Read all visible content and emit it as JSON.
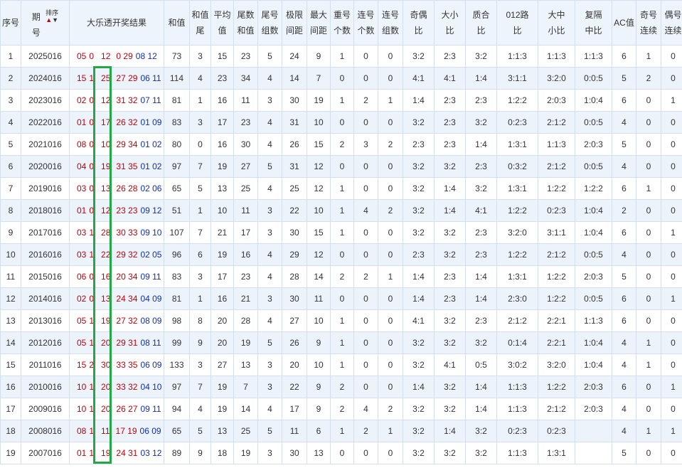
{
  "headers": {
    "seq": "序号",
    "period_l1": "期",
    "period_l2": "号",
    "sort_label": "排序",
    "sort_up": "▲",
    "sort_down": "▼",
    "draw": "大乐透开奖结果",
    "sum": "和值",
    "sum_tail_1": "和值",
    "sum_tail_2": "尾",
    "avg_1": "平均",
    "avg_2": "值",
    "tail_sum_1": "尾数",
    "tail_sum_2": "和值",
    "tail_groups_1": "尾号",
    "tail_groups_2": "组数",
    "span_1": "极限",
    "span_2": "间距",
    "max_gap_1": "最大",
    "max_gap_2": "间距",
    "repeat_1": "重号",
    "repeat_2": "个数",
    "consec_1": "连号",
    "consec_2": "个数",
    "consec_groups_1": "连号",
    "consec_groups_2": "组数",
    "odd_even_1": "奇偶",
    "odd_even_2": "比",
    "big_small_1": "大小",
    "big_small_2": "比",
    "prime_1": "质合",
    "prime_2": "比",
    "road_1": "012路",
    "road_2": "比",
    "bms_1": "大中",
    "bms_2": "小比",
    "rep_1": "复隔",
    "rep_2": "中比",
    "ac": "AC值",
    "odd_run_1": "奇号",
    "odd_run_2": "连续",
    "even_run_1": "偶号",
    "even_run_2": "连续"
  },
  "rows": [
    {
      "seq": "1",
      "period": "2025016",
      "r1": "05",
      "r2": "0",
      "r3": "12",
      "r4": "0 29",
      "b": "08 12",
      "sum": "73",
      "st": "3",
      "avg": "15",
      "ts": "23",
      "tg": "5",
      "sp": "24",
      "mg": "9",
      "rp": "1",
      "cn": "0",
      "cg": "0",
      "oe": "3:2",
      "bs": "2:3",
      "pc": "3:2",
      "rd": "1:1:3",
      "bms": "1:1:3",
      "rep": "1:1:3",
      "ac": "6",
      "or": "1",
      "er": "0"
    },
    {
      "seq": "2",
      "period": "2024016",
      "r1": "15",
      "r2": "1",
      "r3": "25",
      "r4": "27 29",
      "b": "06 11",
      "sum": "114",
      "st": "4",
      "avg": "23",
      "ts": "34",
      "tg": "4",
      "sp": "14",
      "mg": "7",
      "rp": "0",
      "cn": "0",
      "cg": "0",
      "oe": "4:1",
      "bs": "4:1",
      "pc": "1:4",
      "rd": "3:1:1",
      "bms": "3:2:0",
      "rep": "0:0:5",
      "ac": "5",
      "or": "2",
      "er": "0"
    },
    {
      "seq": "3",
      "period": "2023016",
      "r1": "02",
      "r2": "0",
      "r3": "12",
      "r4": "31 32",
      "b": "07 11",
      "sum": "81",
      "st": "1",
      "avg": "16",
      "ts": "11",
      "tg": "3",
      "sp": "30",
      "mg": "19",
      "rp": "1",
      "cn": "2",
      "cg": "1",
      "oe": "1:4",
      "bs": "2:3",
      "pc": "2:3",
      "rd": "1:2:2",
      "bms": "2:0:3",
      "rep": "1:0:4",
      "ac": "6",
      "or": "0",
      "er": "1"
    },
    {
      "seq": "4",
      "period": "2022016",
      "r1": "01",
      "r2": "0",
      "r3": "17",
      "r4": "26 32",
      "b": "01 09",
      "sum": "83",
      "st": "3",
      "avg": "17",
      "ts": "23",
      "tg": "4",
      "sp": "31",
      "mg": "10",
      "rp": "0",
      "cn": "0",
      "cg": "0",
      "oe": "3:2",
      "bs": "2:3",
      "pc": "3:2",
      "rd": "0:2:3",
      "bms": "2:1:2",
      "rep": "0:0:5",
      "ac": "4",
      "or": "0",
      "er": "0"
    },
    {
      "seq": "5",
      "period": "2021016",
      "r1": "08",
      "r2": "0",
      "r3": "10",
      "r4": "29 34",
      "b": "01 02",
      "sum": "80",
      "st": "0",
      "avg": "16",
      "ts": "30",
      "tg": "4",
      "sp": "26",
      "mg": "15",
      "rp": "2",
      "cn": "3",
      "cg": "2",
      "oe": "2:3",
      "bs": "2:3",
      "pc": "1:4",
      "rd": "1:3:1",
      "bms": "1:1:3",
      "rep": "2:0:3",
      "ac": "5",
      "or": "0",
      "er": "0"
    },
    {
      "seq": "6",
      "period": "2020016",
      "r1": "04",
      "r2": "0",
      "r3": "19",
      "r4": "31 35",
      "b": "01 02",
      "sum": "97",
      "st": "7",
      "avg": "19",
      "ts": "27",
      "tg": "5",
      "sp": "31",
      "mg": "12",
      "rp": "0",
      "cn": "0",
      "cg": "0",
      "oe": "3:2",
      "bs": "3:2",
      "pc": "2:3",
      "rd": "0:3:2",
      "bms": "2:1:2",
      "rep": "0:0:5",
      "ac": "4",
      "or": "0",
      "er": "0"
    },
    {
      "seq": "7",
      "period": "2019016",
      "r1": "03",
      "r2": "0",
      "r3": "13",
      "r4": "26 28",
      "b": "02 06",
      "sum": "65",
      "st": "5",
      "avg": "13",
      "ts": "25",
      "tg": "4",
      "sp": "25",
      "mg": "12",
      "rp": "1",
      "cn": "0",
      "cg": "0",
      "oe": "3:2",
      "bs": "1:4",
      "pc": "3:2",
      "rd": "1:3:1",
      "bms": "1:2:2",
      "rep": "1:2:2",
      "ac": "6",
      "or": "1",
      "er": "0"
    },
    {
      "seq": "8",
      "period": "2018016",
      "r1": "01",
      "r2": "0",
      "r3": "12",
      "r4": "23 23",
      "b": "09 12",
      "sum": "51",
      "st": "1",
      "avg": "10",
      "ts": "11",
      "tg": "3",
      "sp": "22",
      "mg": "10",
      "rp": "1",
      "cn": "4",
      "cg": "2",
      "oe": "3:2",
      "bs": "1:4",
      "pc": "4:1",
      "rd": "1:2:2",
      "bms": "0:2:3",
      "rep": "1:0:4",
      "ac": "2",
      "or": "0",
      "er": "0"
    },
    {
      "seq": "9",
      "period": "2017016",
      "r1": "03",
      "r2": "1",
      "r3": "28",
      "r4": "30 33",
      "b": "09 10",
      "sum": "107",
      "st": "7",
      "avg": "21",
      "ts": "17",
      "tg": "3",
      "sp": "30",
      "mg": "15",
      "rp": "1",
      "cn": "0",
      "cg": "0",
      "oe": "3:2",
      "bs": "3:2",
      "pc": "2:3",
      "rd": "3:2:0",
      "bms": "3:1:1",
      "rep": "1:0:4",
      "ac": "6",
      "or": "0",
      "er": "1"
    },
    {
      "seq": "10",
      "period": "2016016",
      "r1": "03",
      "r2": "1",
      "r3": "22",
      "r4": "29 32",
      "b": "02 05",
      "sum": "96",
      "st": "6",
      "avg": "19",
      "ts": "16",
      "tg": "4",
      "sp": "29",
      "mg": "12",
      "rp": "0",
      "cn": "0",
      "cg": "0",
      "oe": "2:3",
      "bs": "3:2",
      "pc": "2:3",
      "rd": "1:2:2",
      "bms": "2:1:2",
      "rep": "0:0:5",
      "ac": "4",
      "or": "0",
      "er": "0"
    },
    {
      "seq": "11",
      "period": "2015016",
      "r1": "06",
      "r2": "0",
      "r3": "16",
      "r4": "20 34",
      "b": "09 11",
      "sum": "83",
      "st": "3",
      "avg": "17",
      "ts": "23",
      "tg": "4",
      "sp": "28",
      "mg": "14",
      "rp": "2",
      "cn": "2",
      "cg": "1",
      "oe": "1:4",
      "bs": "2:3",
      "pc": "1:4",
      "rd": "1:3:1",
      "bms": "1:2:2",
      "rep": "2:0:3",
      "ac": "5",
      "or": "0",
      "er": "0"
    },
    {
      "seq": "12",
      "period": "2014016",
      "r1": "02",
      "r2": "0",
      "r3": "13",
      "r4": "24 34",
      "b": "04 09",
      "sum": "81",
      "st": "1",
      "avg": "16",
      "ts": "21",
      "tg": "3",
      "sp": "30",
      "mg": "11",
      "rp": "0",
      "cn": "0",
      "cg": "0",
      "oe": "1:4",
      "bs": "2:3",
      "pc": "1:4",
      "rd": "2:3:0",
      "bms": "1:2:2",
      "rep": "0:0:5",
      "ac": "6",
      "or": "0",
      "er": "1"
    },
    {
      "seq": "13",
      "period": "2013016",
      "r1": "05",
      "r2": "1",
      "r3": "19",
      "r4": "27 32",
      "b": "08 09",
      "sum": "98",
      "st": "8",
      "avg": "20",
      "ts": "28",
      "tg": "4",
      "sp": "27",
      "mg": "10",
      "rp": "1",
      "cn": "0",
      "cg": "0",
      "oe": "4:1",
      "bs": "3:2",
      "pc": "2:3",
      "rd": "2:1:2",
      "bms": "2:2:1",
      "rep": "1:1:3",
      "ac": "6",
      "or": "0",
      "er": "0"
    },
    {
      "seq": "14",
      "period": "2012016",
      "r1": "05",
      "r2": "1",
      "r3": "20",
      "r4": "29 31",
      "b": "08 11",
      "sum": "99",
      "st": "9",
      "avg": "20",
      "ts": "19",
      "tg": "5",
      "sp": "26",
      "mg": "9",
      "rp": "1",
      "cn": "0",
      "cg": "0",
      "oe": "3:2",
      "bs": "3:2",
      "pc": "3:2",
      "rd": "0:1:4",
      "bms": "2:2:1",
      "rep": "1:0:4",
      "ac": "4",
      "or": "1",
      "er": "0"
    },
    {
      "seq": "15",
      "period": "2011016",
      "r1": "15",
      "r2": "2",
      "r3": "30",
      "r4": "33 35",
      "b": "06 09",
      "sum": "133",
      "st": "3",
      "avg": "27",
      "ts": "13",
      "tg": "3",
      "sp": "20",
      "mg": "10",
      "rp": "1",
      "cn": "0",
      "cg": "0",
      "oe": "3:2",
      "bs": "4:1",
      "pc": "0:5",
      "rd": "3:0:2",
      "bms": "3:2:0",
      "rep": "1:0:4",
      "ac": "4",
      "or": "1",
      "er": "0"
    },
    {
      "seq": "16",
      "period": "2010016",
      "r1": "10",
      "r2": "1",
      "r3": "20",
      "r4": "33 32",
      "b": "04 10",
      "sum": "97",
      "st": "7",
      "avg": "19",
      "ts": "7",
      "tg": "3",
      "sp": "22",
      "mg": "9",
      "rp": "2",
      "cn": "0",
      "cg": "0",
      "oe": "1:4",
      "bs": "3:2",
      "pc": "1:4",
      "rd": "1:1:3",
      "bms": "1:2:2",
      "rep": "2:0:3",
      "ac": "6",
      "or": "0",
      "er": "1"
    },
    {
      "seq": "17",
      "period": "2009016",
      "r1": "10",
      "r2": "1",
      "r3": "20",
      "r4": "26 27",
      "b": "09 11",
      "sum": "94",
      "st": "4",
      "avg": "19",
      "ts": "14",
      "tg": "4",
      "sp": "17",
      "mg": "9",
      "rp": "2",
      "cn": "4",
      "cg": "2",
      "oe": "3:2",
      "bs": "3:2",
      "pc": "1:4",
      "rd": "1:1:3",
      "bms": "2:1:2",
      "rep": "2:0:3",
      "ac": "4",
      "or": "0",
      "er": "0"
    },
    {
      "seq": "18",
      "period": "2008016",
      "r1": "08",
      "r2": "1",
      "r3": "11",
      "r4": "17 19",
      "b": "06 09",
      "sum": "65",
      "st": "5",
      "avg": "13",
      "ts": "25",
      "tg": "5",
      "sp": "11",
      "mg": "6",
      "rp": "1",
      "cn": "2",
      "cg": "1",
      "oe": "3:2",
      "bs": "1:4",
      "pc": "3:2",
      "rd": "0:2:3",
      "bms": "0:2:3",
      "rep": "",
      "ac": "4",
      "or": "1",
      "er": "1"
    },
    {
      "seq": "19",
      "period": "2007016",
      "r1": "01",
      "r2": "1",
      "r3": "19",
      "r4": "24 31",
      "b": "03 12",
      "sum": "89",
      "st": "9",
      "avg": "18",
      "ts": "19",
      "tg": "3",
      "sp": "30",
      "mg": "13",
      "rp": "0",
      "cn": "0",
      "cg": "0",
      "oe": "3:2",
      "bs": "3:2",
      "pc": "3:2",
      "rd": "1:1:3",
      "bms": "1:3:1",
      "rep": "",
      "ac": "5",
      "or": "0",
      "er": "0"
    }
  ],
  "colors": {
    "red": "#c0000c",
    "blue": "#1030b0",
    "highlight": "#22a844",
    "header_bg": "#eef4fb",
    "row_alt": "#ecf3fb"
  }
}
